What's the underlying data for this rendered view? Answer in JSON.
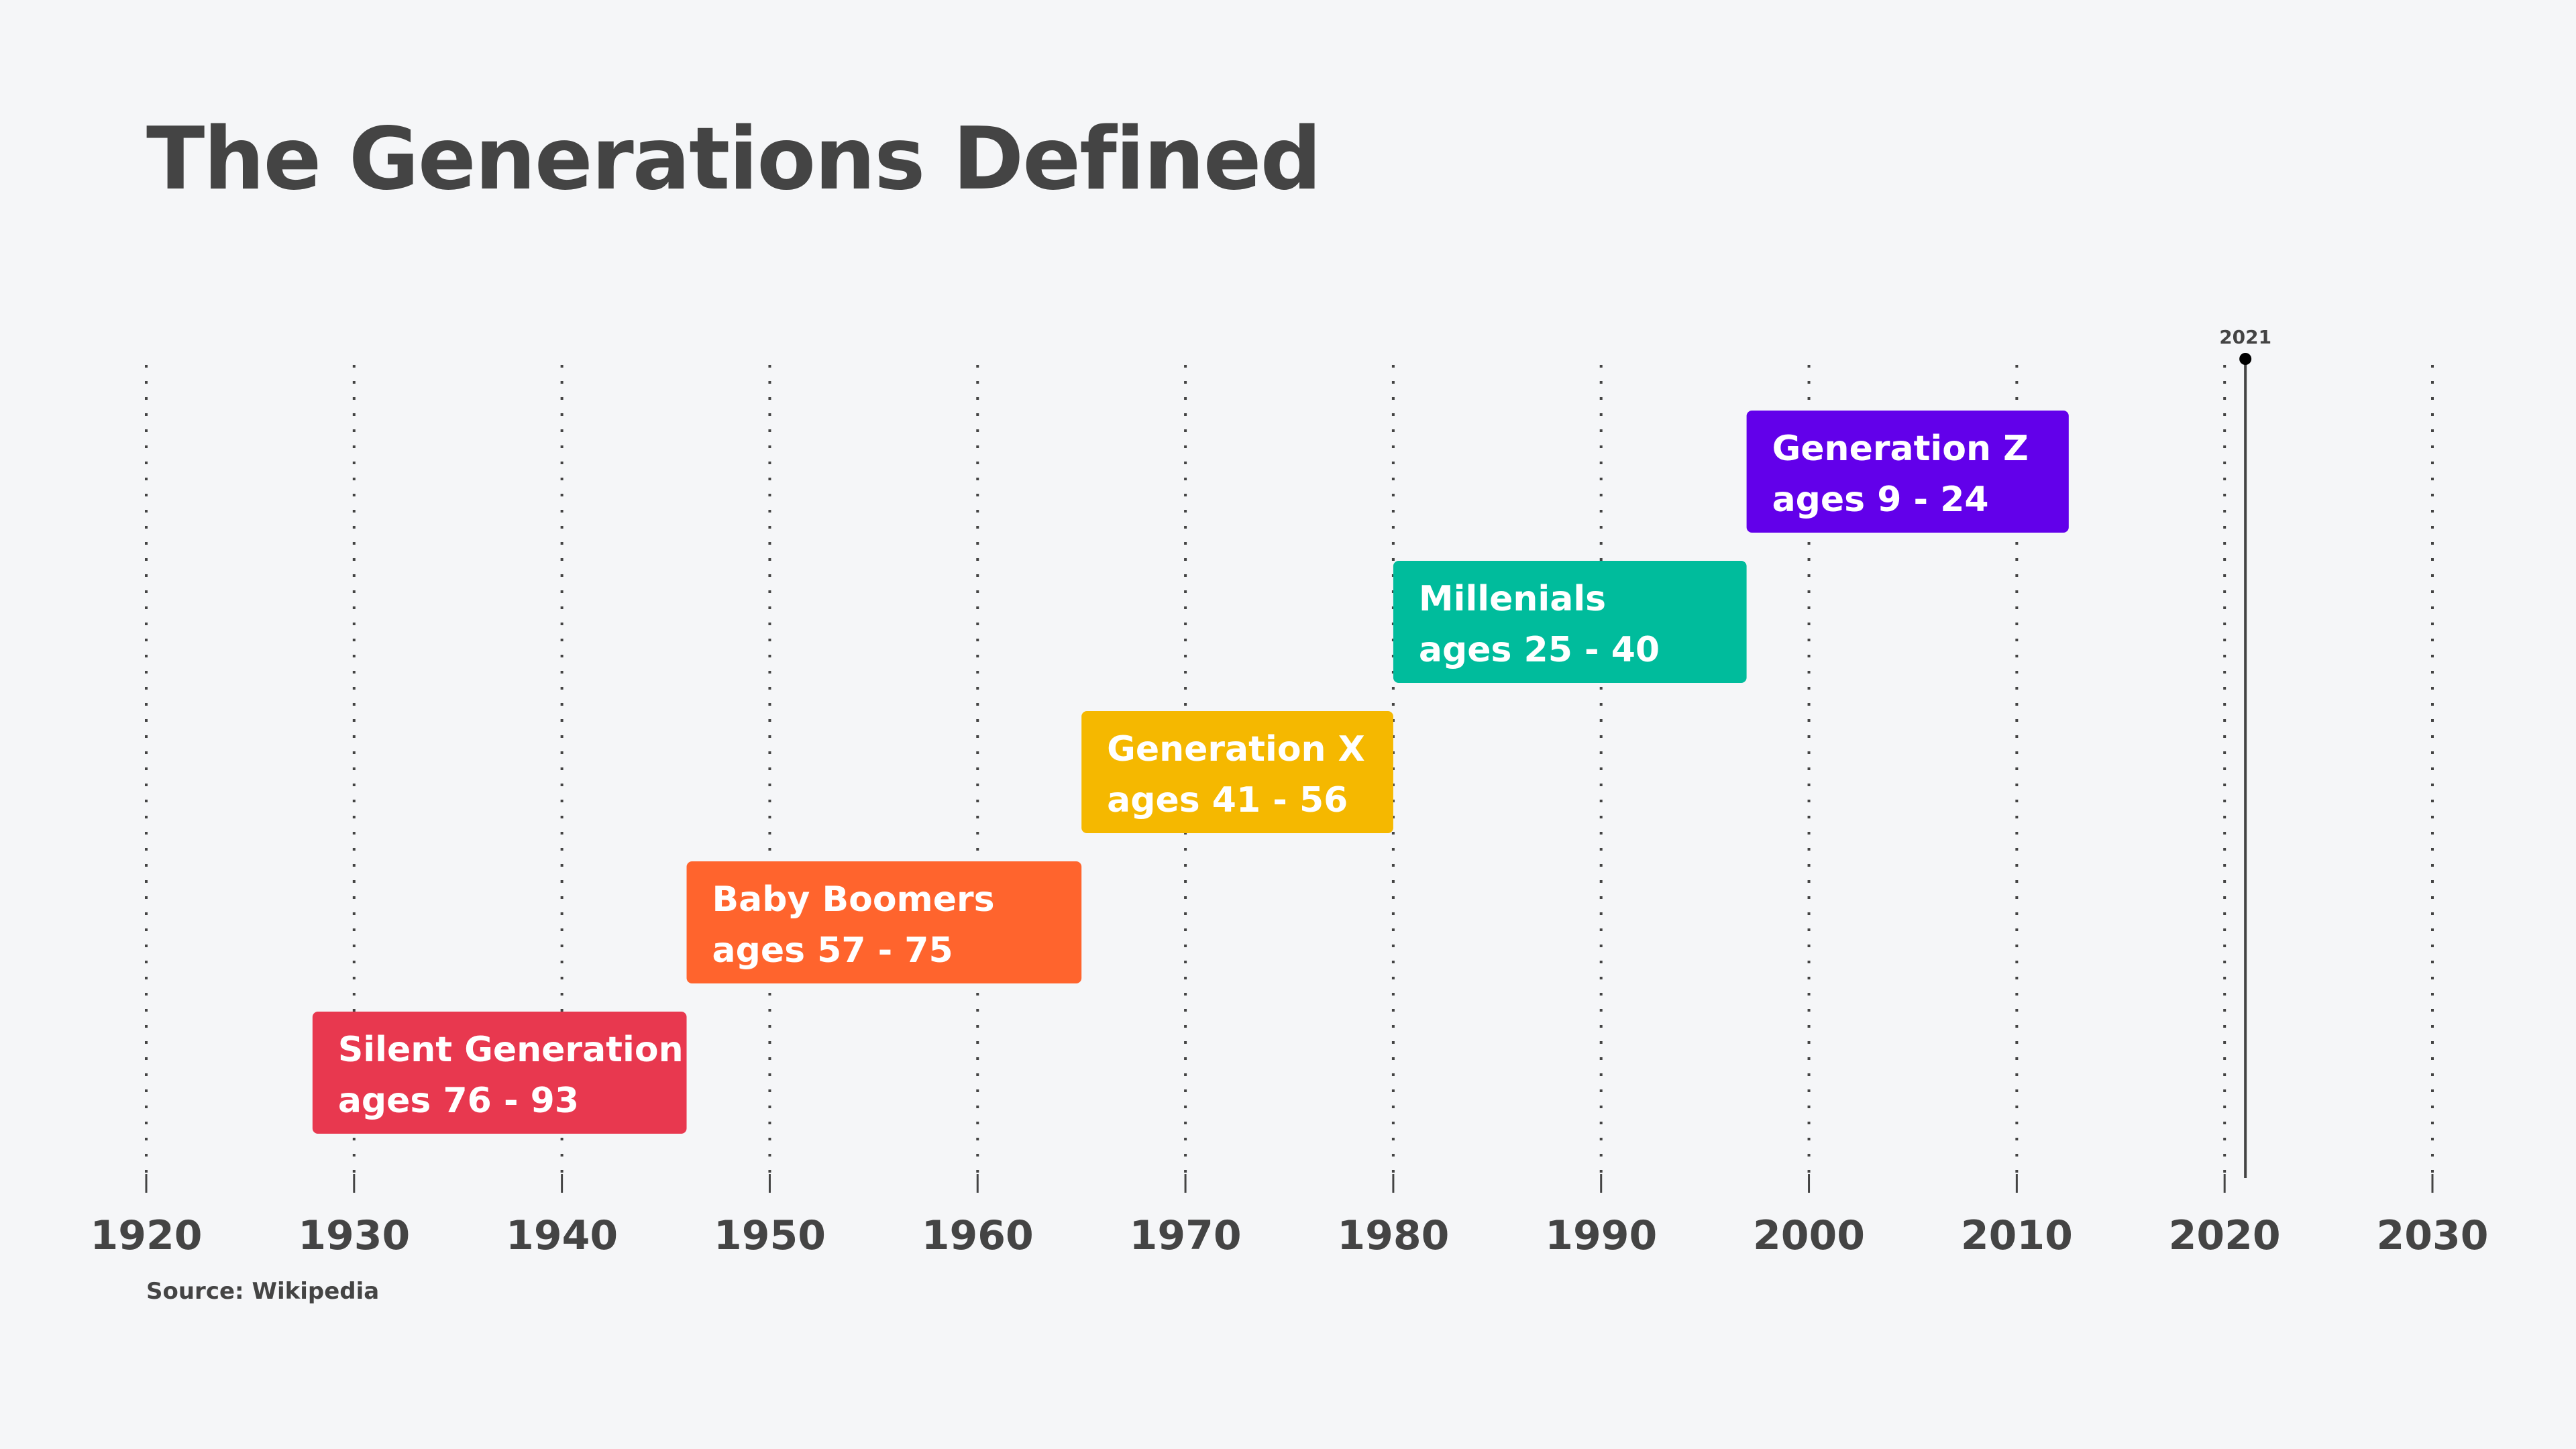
{
  "title": "The Generations Defined",
  "source": "Source: Wikipedia",
  "colors": {
    "background": "#F5F6F8",
    "text": "#444444",
    "gridline": "#444444"
  },
  "chart_data": {
    "type": "timeline",
    "title": "The Generations Defined",
    "xlabel": "",
    "ylabel": "",
    "x_range": [
      1920,
      2030
    ],
    "x_ticks": [
      1920,
      1930,
      1940,
      1950,
      1960,
      1970,
      1980,
      1990,
      2000,
      2010,
      2020,
      2030
    ],
    "grid": true,
    "reference_marker": {
      "year": 2021,
      "label": "2021"
    },
    "series": [
      {
        "name": "Silent Generation",
        "label": "ages 76 - 93",
        "start": 1928,
        "end": 1946,
        "color": "#E8384F"
      },
      {
        "name": "Baby Boomers",
        "label": "ages 57 - 75",
        "start": 1946,
        "end": 1965,
        "color": "#FF642D"
      },
      {
        "name": "Generation X",
        "label": "ages 41 - 56",
        "start": 1965,
        "end": 1980,
        "color": "#F5B800"
      },
      {
        "name": "Millenials",
        "label": "ages 25 - 40",
        "start": 1980,
        "end": 1997,
        "color": "#00BC9C"
      },
      {
        "name": "Generation Z",
        "label": "ages 9 - 24",
        "start": 1997,
        "end": 2012.5,
        "color": "#6200EA"
      }
    ]
  }
}
